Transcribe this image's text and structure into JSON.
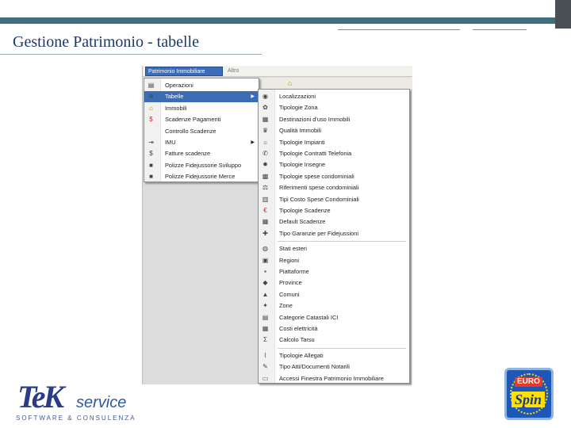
{
  "slide": {
    "title": "Gestione Patrimonio - tabelle"
  },
  "app": {
    "menubar": {
      "active": "Patrimonio Immobiliare",
      "next": "Altro"
    }
  },
  "menu1": {
    "items": [
      {
        "label": "Operazioni",
        "icon": "document-icon"
      },
      {
        "label": "Tabelle",
        "icon": "tables-icon",
        "highlighted": true,
        "submenu": true
      },
      {
        "label": "Immobili",
        "icon": "house-icon"
      },
      {
        "label": "Scadenze Pagamenti",
        "icon": "dollar-icon"
      },
      {
        "label": "Controllo Scadenze",
        "icon": ""
      },
      {
        "label": "IMU",
        "icon": "tax-icon",
        "submenu": true
      },
      {
        "label": "Fatture scadenze",
        "icon": "money-icon"
      },
      {
        "label": "Polizze Fidejussorie Sviluppo",
        "icon": "truck-icon"
      },
      {
        "label": "Polizze Fidejussorie Merce",
        "icon": "truck-icon"
      }
    ]
  },
  "menu2": {
    "items": [
      {
        "label": "Localizzazioni",
        "icon": "globe-icon"
      },
      {
        "label": "Tipologie Zona",
        "icon": "zone-icon"
      },
      {
        "label": "Destinazioni d'uso Immobili",
        "icon": "building-icon"
      },
      {
        "label": "Qualità Immobili",
        "icon": "crown-icon"
      },
      {
        "label": "Tipologie Impianti",
        "icon": "plant-icon"
      },
      {
        "label": "Tipologie Contratti Telefonia",
        "icon": "phone-icon"
      },
      {
        "label": "Tipologie Insegne",
        "icon": "sign-icon"
      },
      {
        "label": "Tipologie spese condominiali",
        "icon": "condo-icon"
      },
      {
        "label": "Riferimenti spese condominiali",
        "icon": "balance-icon"
      },
      {
        "label": "Tipi Costo Spese Condominiali",
        "icon": "chart-icon"
      },
      {
        "label": "Tipologie Scadenze",
        "icon": "euro-icon"
      },
      {
        "label": "Default Scadenze",
        "icon": "building-icon"
      },
      {
        "label": "Tipo Garanzie per Fidejussioni",
        "icon": "guarantee-icon"
      },
      {
        "label": "Stati esteri",
        "icon": "world-icon"
      },
      {
        "label": "Regioni",
        "icon": "region-icon"
      },
      {
        "label": "Piattaforme",
        "icon": "platform-icon"
      },
      {
        "label": "Province",
        "icon": "province-icon"
      },
      {
        "label": "Comuni",
        "icon": "town-icon"
      },
      {
        "label": "Zone",
        "icon": "zones-icon"
      },
      {
        "label": "Categorie Catastali ICI",
        "icon": "cadastre-icon"
      },
      {
        "label": "Costi elettricità",
        "icon": "electricity-icon"
      },
      {
        "label": "Calcolo Tarsu",
        "icon": "sigma-icon"
      },
      {
        "label": "Tipologie Allegati",
        "icon": "attachment-icon"
      },
      {
        "label": "Tipo Atti/Documenti Notarili",
        "icon": "notary-icon"
      },
      {
        "label": "Accessi Finestra Patrimonio Immobiliare",
        "icon": "access-icon"
      }
    ]
  },
  "logos": {
    "tek": {
      "big": "TeK",
      "service": "service",
      "sub": "SOFTWARE & CONSULENZA"
    },
    "euro": {
      "top": "EURO",
      "bottom": "Spin"
    }
  },
  "colors": {
    "highlight": "#3b6cb5",
    "banner": "#3f6f7a",
    "title": "#1b3a6b"
  }
}
